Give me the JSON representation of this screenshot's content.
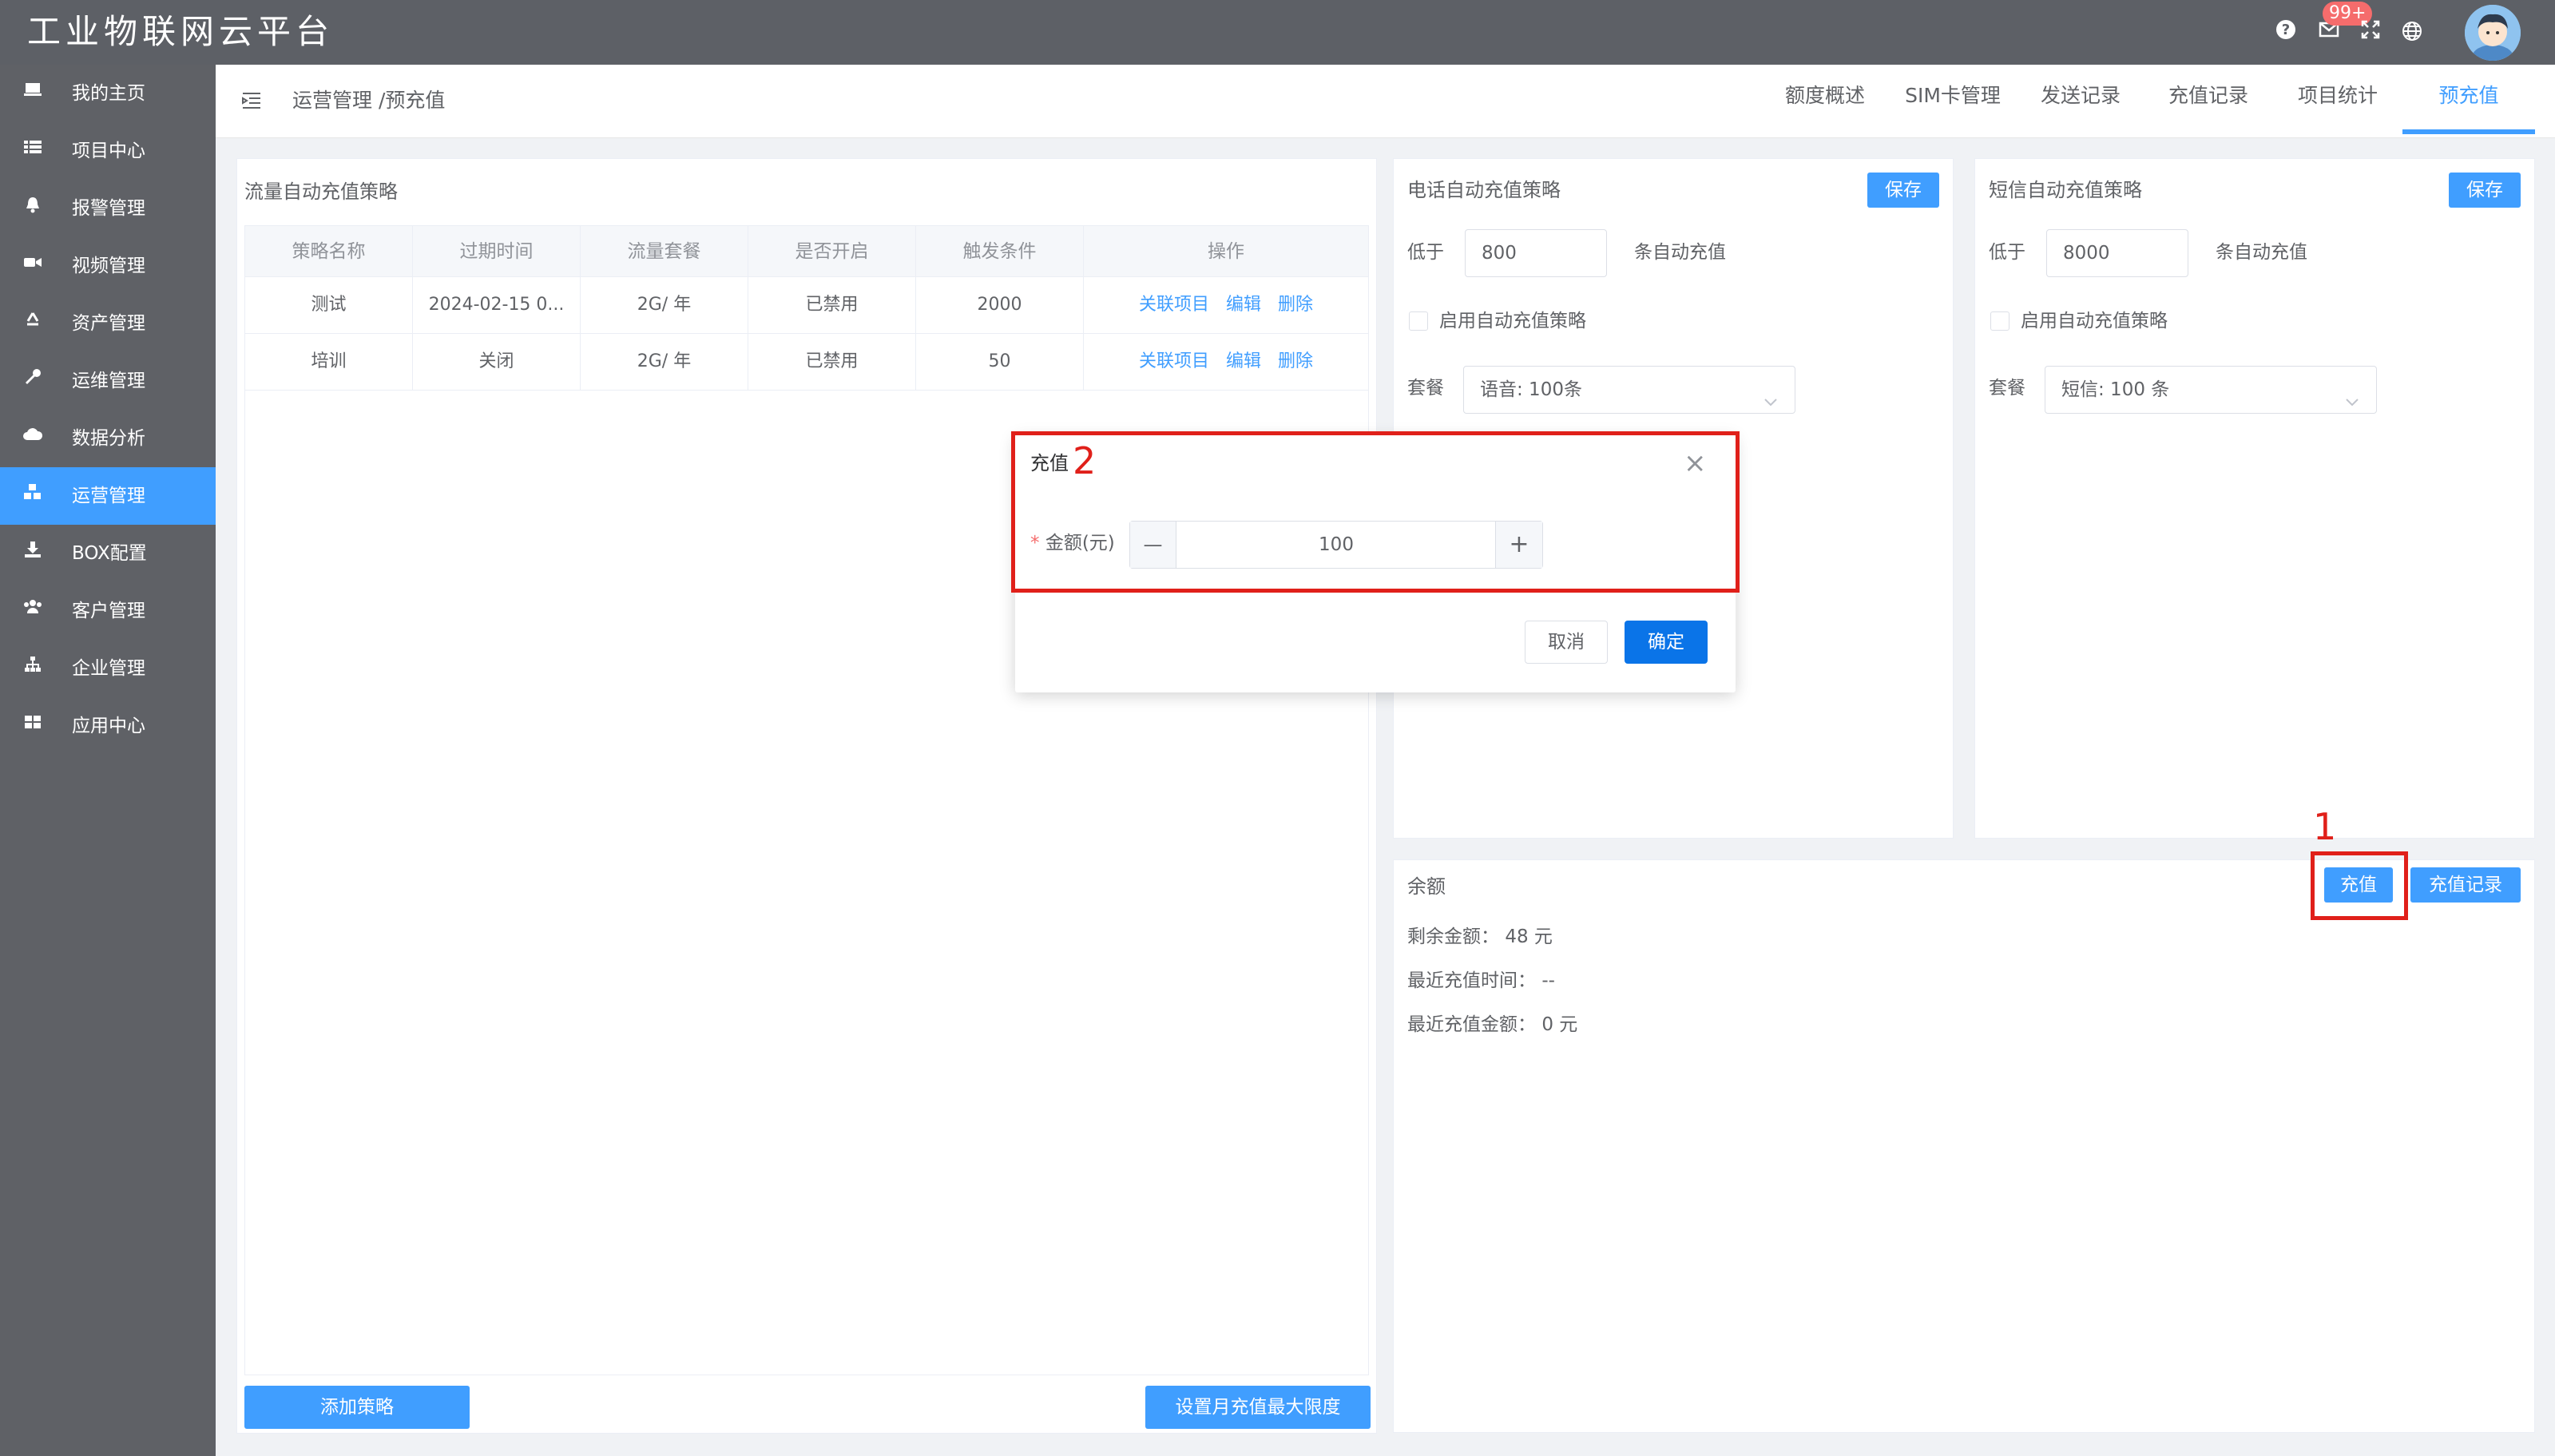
{
  "header": {
    "app_title": "工业物联网云平台",
    "notification_badge": "99+",
    "icons": [
      "help-icon",
      "mail-icon",
      "fullscreen-icon",
      "globe-icon"
    ]
  },
  "sidebar": {
    "items": [
      {
        "label": "我的主页",
        "icon": "monitor-icon"
      },
      {
        "label": "项目中心",
        "icon": "list-icon"
      },
      {
        "label": "报警管理",
        "icon": "bell-icon"
      },
      {
        "label": "视频管理",
        "icon": "video-icon"
      },
      {
        "label": "资产管理",
        "icon": "recycle-icon"
      },
      {
        "label": "运维管理",
        "icon": "wrench-icon"
      },
      {
        "label": "数据分析",
        "icon": "cloud-icon"
      },
      {
        "label": "运营管理",
        "icon": "cubes-icon"
      },
      {
        "label": "BOX配置",
        "icon": "download-icon"
      },
      {
        "label": "客户管理",
        "icon": "users-icon"
      },
      {
        "label": "企业管理",
        "icon": "sitemap-icon"
      },
      {
        "label": "应用中心",
        "icon": "grid-icon"
      }
    ],
    "active_index": 7,
    "active_color": "#409eff"
  },
  "breadcrumb": "运营管理 /预充值",
  "tabs": [
    "额度概述",
    "SIM卡管理",
    "发送记录",
    "充值记录",
    "项目统计",
    "预充值"
  ],
  "active_tab": "预充值",
  "flow_panel": {
    "title": "流量自动充值策略",
    "columns": [
      "策略名称",
      "过期时间",
      "流量套餐",
      "是否开启",
      "触发条件",
      "操作"
    ],
    "rows": [
      {
        "name": "测试",
        "expire": "2024-02-15 0...",
        "package": "2G/ 年",
        "enabled": "已禁用",
        "trigger": "2000"
      },
      {
        "name": "培训",
        "expire": "关闭",
        "package": "2G/ 年",
        "enabled": "已禁用",
        "trigger": "50"
      }
    ],
    "actions": [
      "关联项目",
      "编辑",
      "删除"
    ],
    "add_button": "添加策略",
    "max_button": "设置月充值最大限度"
  },
  "phone_panel": {
    "title": "电话自动充值策略",
    "save": "保存",
    "below_label": "低于",
    "threshold": "800",
    "suffix": "条自动充值",
    "checkbox_label": "启用自动充值策略",
    "package_label": "套餐",
    "package_value": "语音: 100条"
  },
  "sms_panel": {
    "title": "短信自动充值策略",
    "save": "保存",
    "below_label": "低于",
    "threshold": "8000",
    "suffix": "条自动充值",
    "checkbox_label": "启用自动充值策略",
    "package_label": "套餐",
    "package_value": "短信: 100 条"
  },
  "balance_panel": {
    "title": "余额",
    "recharge_button": "充值",
    "history_button": "充值记录",
    "remaining_label": "剩余金额：",
    "remaining_value": "48 元",
    "last_time_label": "最近充值时间：",
    "last_time_value": "--",
    "last_amount_label": "最近充值金额：",
    "last_amount_value": "0 元"
  },
  "modal": {
    "title": "充值",
    "amount_label": "金额(元)",
    "amount_value": "100",
    "minus": "—",
    "plus": "+",
    "cancel": "取消",
    "confirm": "确定",
    "close": "×"
  },
  "annotations": {
    "step1": "1",
    "step2": "2",
    "highlight_color": "#e0201a"
  }
}
